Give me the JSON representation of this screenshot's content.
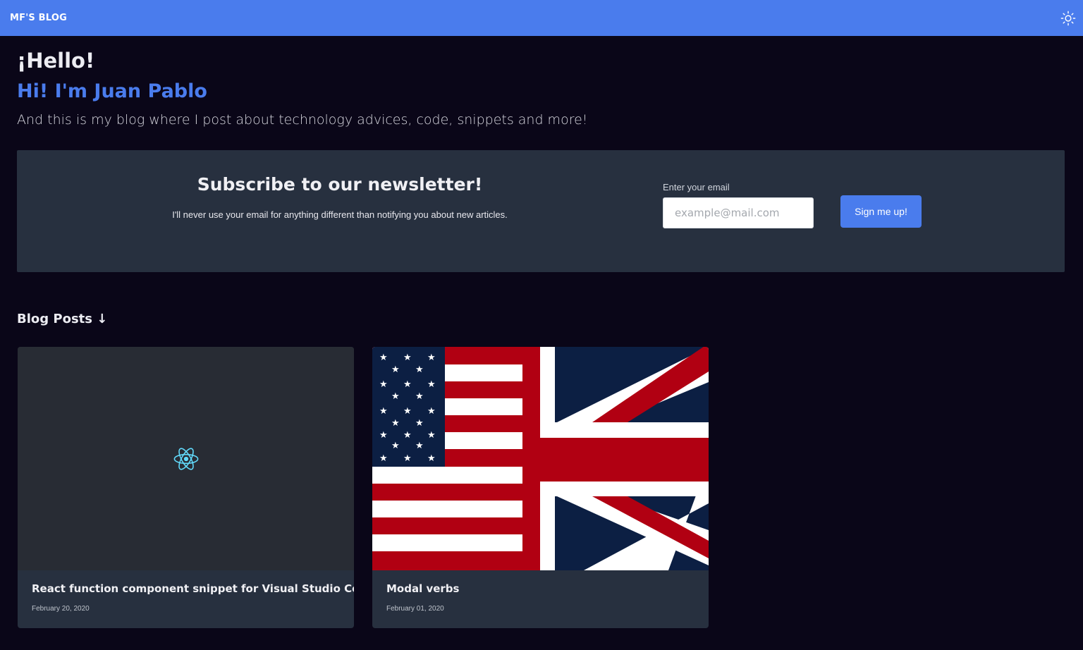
{
  "nav": {
    "brand": "MF'S BLOG",
    "theme_icon": "sun-icon"
  },
  "hero": {
    "greeting": "¡Hello!",
    "intro_name": "Hi! I'm Juan Pablo",
    "intro_text": "And this is my blog where I post about technology advices, code, snippets and more!"
  },
  "newsletter": {
    "title": "Subscribe to our newsletter!",
    "description": "I'll never use your email for anything different than notifying you about new articles.",
    "email_label": "Enter your email",
    "email_placeholder": "example@mail.com",
    "email_value": "",
    "button_label": "Sign me up!"
  },
  "posts": {
    "heading": "Blog Posts ↓",
    "items": [
      {
        "title": "React function component snippet for Visual Studio Code",
        "date": "February 20, 2020",
        "image_icon": "react-logo-icon"
      },
      {
        "title": "Modal verbs",
        "date": "February 01, 2020",
        "image_icon": "us-uk-flag-image"
      }
    ]
  },
  "colors": {
    "accent": "#4a7ced",
    "background": "#0a0618",
    "panel": "#27303f",
    "react_blue": "#61dafb"
  }
}
